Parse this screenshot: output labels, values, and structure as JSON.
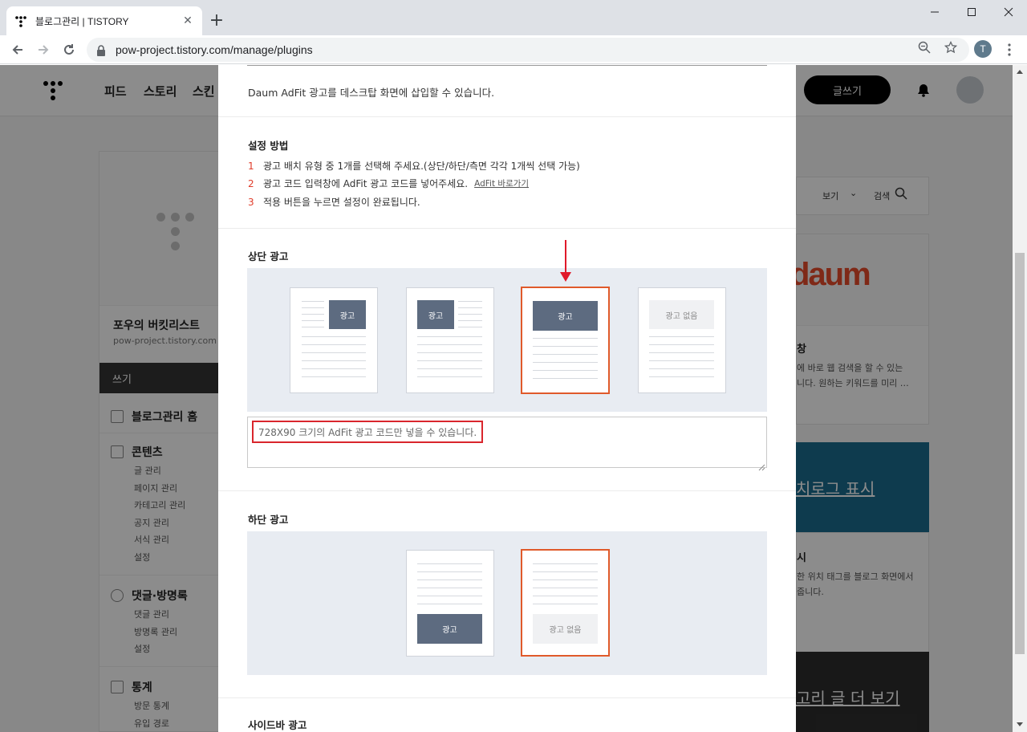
{
  "browser": {
    "tab_title": "블로그관리 | TISTORY",
    "url": "pow-project.tistory.com/manage/plugins",
    "profile_initial": "T"
  },
  "site": {
    "gnb": [
      "피드",
      "스토리",
      "스킨"
    ],
    "write_label": "글쓰기",
    "blog_name": "포우의 버킷리스트",
    "blog_url": "pow-project.tistory.com",
    "side_write": "쓰기",
    "side_home": "블로그관리 홈",
    "side_contents": "콘텐츠",
    "side_contents_items": [
      "글 관리",
      "페이지 관리",
      "카테고리 관리",
      "공지 관리",
      "서식 관리",
      "설정"
    ],
    "side_comments": "댓글·방명록",
    "side_comments_items": [
      "댓글 관리",
      "방명록 관리",
      "설정"
    ],
    "side_stats": "통계",
    "side_stats_items": [
      "방문 통계",
      "유입 경로"
    ],
    "view_label": "보기",
    "search_label": "검색",
    "daum_logo": "daum",
    "daum_title_tail": "창",
    "daum_desc_1": "에 바로 웹 검색을 할 수 있는",
    "daum_desc_2": "니다. 원하는 키워드를 미리 …",
    "blue_card_text": "치로그 표시",
    "loc_title_tail": "시",
    "loc_desc_1": "한 위치 태그를 블로그 화면에서",
    "loc_desc_2": "줍니다.",
    "dark_card_text": "고리 글 더 보기"
  },
  "modal": {
    "description": "Daum AdFit 광고를 데스크탑 화면에 삽입할 수 있습니다.",
    "setup_title": "설정 방법",
    "steps": [
      {
        "num": "1",
        "text": "광고 배치 유형 중 1개를 선택해 주세요.(상단/하단/측면 각각 1개씩 선택 가능)"
      },
      {
        "num": "2",
        "text": "광고 코드 입력창에 AdFit 광고 코드를 넣어주세요.",
        "link": "AdFit 바로가기"
      },
      {
        "num": "3",
        "text": "적용 버튼을 누르면 설정이 완료됩니다."
      }
    ],
    "top_ad_title": "상단 광고",
    "ad_label": "광고",
    "no_ad_label": "광고 없음",
    "code_placeholder": "728X90 크기의 AdFit 광고 코드만 넣을 수 있습니다.",
    "bottom_ad_title": "하단 광고",
    "sidebar_ad_title": "사이드바 광고"
  },
  "colors": {
    "selected_border": "#e05a2b",
    "annotation_red": "#e0192a",
    "ad_box": "#5d6b80"
  }
}
